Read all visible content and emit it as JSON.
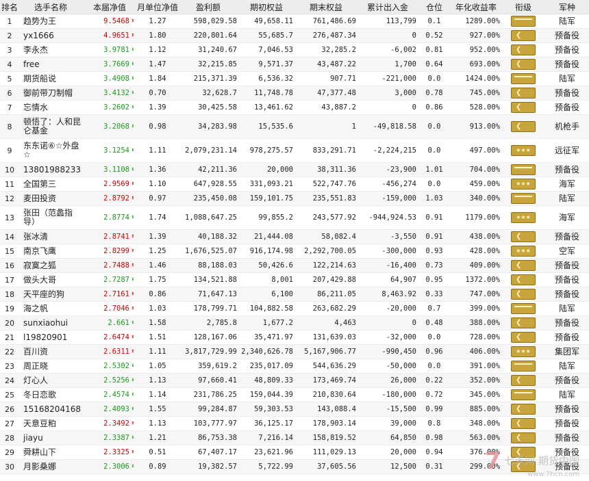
{
  "headers": [
    "排名",
    "选手名称",
    "本届净值",
    "月单位净值",
    "盈利额",
    "期初权益",
    "期末权益",
    "累计出入金",
    "仓位",
    "年化收益率",
    "衔级",
    "军种"
  ],
  "rows": [
    {
      "rank": "1",
      "name": "趋势为王",
      "nav": "9.5468",
      "dir": "up",
      "mnav": "1.27",
      "profit": "598,029.58",
      "begin": "49,658.11",
      "end": "761,486.69",
      "flow": "113,799",
      "pos": "0.1",
      "annual": "1289.00%",
      "badge": "s1",
      "army": "陆军"
    },
    {
      "rank": "2",
      "name": "yx1666",
      "nav": "4.9651",
      "dir": "up",
      "mnav": "1.80",
      "profit": "220,801.64",
      "begin": "55,685.7",
      "end": "276,487.34",
      "flow": "0",
      "pos": "0.52",
      "annual": "927.00%",
      "badge": "chev",
      "army": "预备役"
    },
    {
      "rank": "3",
      "name": "李永杰",
      "nav": "3.9781",
      "dir": "down",
      "mnav": "1.12",
      "profit": "31,240.67",
      "begin": "7,046.53",
      "end": "32,285.2",
      "flow": "-6,002",
      "pos": "0.81",
      "annual": "952.00%",
      "badge": "chev",
      "army": "预备役"
    },
    {
      "rank": "4",
      "name": "free",
      "nav": "3.7669",
      "dir": "down",
      "mnav": "1.47",
      "profit": "32,215.85",
      "begin": "9,571.37",
      "end": "43,487.22",
      "flow": "1,700",
      "pos": "0.64",
      "annual": "693.00%",
      "badge": "chev",
      "army": "预备役"
    },
    {
      "rank": "5",
      "name": "期货船说",
      "nav": "3.4908",
      "dir": "down",
      "mnav": "1.84",
      "profit": "215,371.39",
      "begin": "6,536.32",
      "end": "907.71",
      "flow": "-221,000",
      "pos": "0.0",
      "annual": "1424.00%",
      "badge": "s1",
      "army": "陆军"
    },
    {
      "rank": "6",
      "name": "御前带刀制帽",
      "nav": "3.4132",
      "dir": "down",
      "mnav": "0.70",
      "profit": "32,628.7",
      "begin": "11,748.78",
      "end": "47,377.48",
      "flow": "3,000",
      "pos": "0.78",
      "annual": "745.00%",
      "badge": "chev",
      "army": "预备役"
    },
    {
      "rank": "7",
      "name": "忘情水",
      "nav": "3.2602",
      "dir": "down",
      "mnav": "1.39",
      "profit": "30,425.58",
      "begin": "13,461.62",
      "end": "43,887.2",
      "flow": "0",
      "pos": "0.86",
      "annual": "528.00%",
      "badge": "chev",
      "army": "预备役"
    },
    {
      "rank": "8",
      "name": "顿悟了：人和昆仑基金",
      "nav": "3.2068",
      "dir": "down",
      "mnav": "0.98",
      "profit": "34,283.98",
      "begin": "15,535.6",
      "end": "1",
      "flow": "-49,818.58",
      "pos": "0.0",
      "annual": "913.00%",
      "badge": "chev",
      "army": "机枪手",
      "tall": true
    },
    {
      "rank": "9",
      "name": "东东诺⑥☆外盘☆",
      "nav": "3.1254",
      "dir": "down",
      "mnav": "1.11",
      "profit": "2,079,231.14",
      "begin": "978,275.57",
      "end": "833,291.71",
      "flow": "-2,224,215",
      "pos": "0.0",
      "annual": "497.00%",
      "badge": "stars",
      "army": "远征军",
      "tall": true
    },
    {
      "rank": "10",
      "name": "13801988233",
      "nav": "3.1108",
      "dir": "down",
      "mnav": "1.36",
      "profit": "42,211.36",
      "begin": "20,000",
      "end": "38,311.36",
      "flow": "-23,900",
      "pos": "1.01",
      "annual": "704.00%",
      "badge": "s2",
      "army": "预备役"
    },
    {
      "rank": "11",
      "name": "全国第三",
      "nav": "2.9569",
      "dir": "up",
      "mnav": "1.10",
      "profit": "647,928.55",
      "begin": "331,093.21",
      "end": "522,747.76",
      "flow": "-456,274",
      "pos": "0.0",
      "annual": "459.00%",
      "badge": "stars",
      "army": "海军"
    },
    {
      "rank": "12",
      "name": "麦田投资",
      "nav": "2.8792",
      "dir": "up",
      "mnav": "0.97",
      "profit": "235,450.08",
      "begin": "159,101.75",
      "end": "235,551.83",
      "flow": "-159,000",
      "pos": "1.03",
      "annual": "340.00%",
      "badge": "s1",
      "army": "陆军"
    },
    {
      "rank": "13",
      "name": "张田（范蠡指导）",
      "nav": "2.8774",
      "dir": "down",
      "mnav": "1.74",
      "profit": "1,088,647.25",
      "begin": "99,855.2",
      "end": "243,577.92",
      "flow": "-944,924.53",
      "pos": "0.91",
      "annual": "1179.00%",
      "badge": "stars",
      "army": "海军",
      "tall": true
    },
    {
      "rank": "14",
      "name": "张冰清",
      "nav": "2.8741",
      "dir": "up",
      "mnav": "1.39",
      "profit": "40,188.32",
      "begin": "21,444.08",
      "end": "58,082.4",
      "flow": "-3,550",
      "pos": "0.91",
      "annual": "438.00%",
      "badge": "chev",
      "army": "预备役"
    },
    {
      "rank": "15",
      "name": "南京飞鹰",
      "nav": "2.8299",
      "dir": "up",
      "mnav": "1.25",
      "profit": "1,676,525.07",
      "begin": "916,174.98",
      "end": "2,292,700.05",
      "flow": "-300,000",
      "pos": "0.93",
      "annual": "428.00%",
      "badge": "stars",
      "army": "空军"
    },
    {
      "rank": "16",
      "name": "寂寞之狐",
      "nav": "2.7488",
      "dir": "up",
      "mnav": "1.46",
      "profit": "88,188.03",
      "begin": "50,426.6",
      "end": "122,214.63",
      "flow": "-16,400",
      "pos": "0.73",
      "annual": "409.00%",
      "badge": "chev",
      "army": "预备役"
    },
    {
      "rank": "17",
      "name": "做头大哥",
      "nav": "2.7287",
      "dir": "down",
      "mnav": "1.75",
      "profit": "134,521.88",
      "begin": "8,001",
      "end": "207,429.88",
      "flow": "64,907",
      "pos": "0.95",
      "annual": "1372.00%",
      "badge": "chev",
      "army": "预备役"
    },
    {
      "rank": "18",
      "name": "天平座的狗",
      "nav": "2.7161",
      "dir": "up",
      "mnav": "0.86",
      "profit": "71,647.13",
      "begin": "6,100",
      "end": "86,211.05",
      "flow": "8,463.92",
      "pos": "0.33",
      "annual": "747.00%",
      "badge": "chev",
      "army": "预备役"
    },
    {
      "rank": "19",
      "name": "海之帆",
      "nav": "2.7046",
      "dir": "up",
      "mnav": "1.03",
      "profit": "178,799.71",
      "begin": "104,882.58",
      "end": "263,682.29",
      "flow": "-20,000",
      "pos": "0.7",
      "annual": "399.00%",
      "badge": "s1",
      "army": "陆军"
    },
    {
      "rank": "20",
      "name": "sunxiaohui",
      "nav": "2.661",
      "dir": "down",
      "mnav": "1.58",
      "profit": "2,785.8",
      "begin": "1,677.2",
      "end": "4,463",
      "flow": "0",
      "pos": "0.48",
      "annual": "388.00%",
      "badge": "chev",
      "army": "预备役"
    },
    {
      "rank": "21",
      "name": "l19820901",
      "nav": "2.6474",
      "dir": "up",
      "mnav": "1.51",
      "profit": "128,167.06",
      "begin": "35,471.97",
      "end": "131,639.03",
      "flow": "-32,000",
      "pos": "0.0",
      "annual": "728.00%",
      "badge": "chev",
      "army": "预备役"
    },
    {
      "rank": "22",
      "name": "百川资",
      "nav": "2.6311",
      "dir": "up",
      "mnav": "1.11",
      "profit": "3,817,729.99",
      "begin": "2,340,626.78",
      "end": "5,167,906.77",
      "flow": "-990,450",
      "pos": "0.96",
      "annual": "406.00%",
      "badge": "stars",
      "army": "集团军"
    },
    {
      "rank": "23",
      "name": "周正晓",
      "nav": "2.5302",
      "dir": "down",
      "mnav": "1.05",
      "profit": "359,619.2",
      "begin": "235,017.09",
      "end": "544,636.29",
      "flow": "-50,000",
      "pos": "0.0",
      "annual": "391.00%",
      "badge": "s1",
      "army": "陆军"
    },
    {
      "rank": "24",
      "name": "灯心人",
      "nav": "2.5256",
      "dir": "down",
      "mnav": "1.13",
      "profit": "97,660.41",
      "begin": "48,809.33",
      "end": "173,469.74",
      "flow": "26,000",
      "pos": "0.22",
      "annual": "352.00%",
      "badge": "chev",
      "army": "预备役"
    },
    {
      "rank": "25",
      "name": "冬日恋歌",
      "nav": "2.4574",
      "dir": "down",
      "mnav": "1.14",
      "profit": "231,786.25",
      "begin": "159,044.39",
      "end": "210,830.64",
      "flow": "-180,000",
      "pos": "0.72",
      "annual": "345.00%",
      "badge": "s1",
      "army": "陆军"
    },
    {
      "rank": "26",
      "name": "15168204168",
      "nav": "2.4093",
      "dir": "down",
      "mnav": "1.55",
      "profit": "99,284.87",
      "begin": "59,303.53",
      "end": "143,088.4",
      "flow": "-15,500",
      "pos": "0.99",
      "annual": "885.00%",
      "badge": "chev",
      "army": "预备役"
    },
    {
      "rank": "27",
      "name": "天意豆粕",
      "nav": "2.3492",
      "dir": "up",
      "mnav": "1.13",
      "profit": "103,777.97",
      "begin": "36,125.17",
      "end": "178,903.14",
      "flow": "39,000",
      "pos": "0.8",
      "annual": "348.00%",
      "badge": "chev",
      "army": "预备役"
    },
    {
      "rank": "28",
      "name": "jiayu",
      "nav": "2.3387",
      "dir": "down",
      "mnav": "1.21",
      "profit": "86,753.38",
      "begin": "7,216.14",
      "end": "158,819.52",
      "flow": "64,850",
      "pos": "0.98",
      "annual": "563.00%",
      "badge": "chev",
      "army": "预备役"
    },
    {
      "rank": "29",
      "name": "舜耕山下",
      "nav": "2.3325",
      "dir": "up",
      "mnav": "0.51",
      "profit": "67,407.17",
      "begin": "23,621.96",
      "end": "111,029.13",
      "flow": "20,000",
      "pos": "0.94",
      "annual": "376.00%",
      "badge": "chev",
      "army": "预备役"
    },
    {
      "rank": "30",
      "name": "月影桑娜",
      "nav": "2.3006",
      "dir": "down",
      "mnav": "0.89",
      "profit": "19,382.57",
      "begin": "5,722.99",
      "end": "37,605.56",
      "flow": "12,500",
      "pos": "0.31",
      "annual": "299.00%",
      "badge": "chev",
      "army": "预备役"
    }
  ],
  "watermark": {
    "brand": "七禾网 期货中国",
    "site": "www.7hcn.com",
    "logo": "7"
  }
}
